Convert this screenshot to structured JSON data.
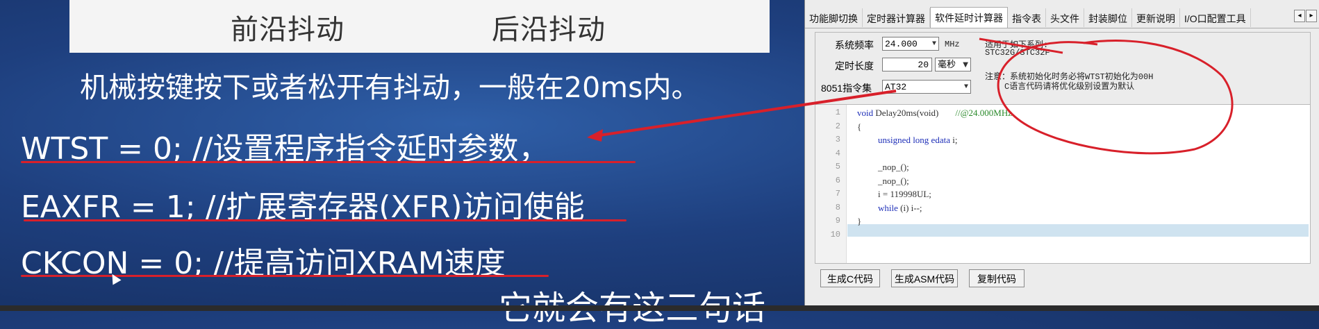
{
  "slide": {
    "figure_labels": [
      "前沿抖动",
      "后沿抖动"
    ],
    "description": "机械按键按下或者松开有抖动，一般在20ms内。",
    "code_lines": [
      "WTST = 0;  //设置程序指令延时参数，",
      "EAXFR = 1; //扩展寄存器(XFR)访问使能",
      "CKCON = 0; //提高访问XRAM速度"
    ],
    "caption_fragment": "它就会有这三句话"
  },
  "tool": {
    "tabs": [
      "功能脚切换",
      "定时器计算器",
      "软件延时计算器",
      "指令表",
      "头文件",
      "封装脚位",
      "更新说明",
      "I/O口配置工具"
    ],
    "active_tab": "软件延时计算器",
    "scroll_left": "◂",
    "scroll_right": "▸",
    "freq_label": "系统频率",
    "freq_value": "24.000",
    "freq_unit": "MHz",
    "delay_label": "定时长度",
    "delay_value": "20",
    "delay_unit": "毫秒",
    "isa_label": "8051指令集",
    "isa_value": "AT32",
    "note_lines": [
      "适用于如下系列:",
      "STC32G/STC32F",
      "注意：系统初始化时务必将WTST初始化为00H",
      "C语言代码请将优化级别设置为默认"
    ],
    "line_numbers": [
      "1",
      "2",
      "3",
      "4",
      "5",
      "6",
      "7",
      "8",
      "9",
      "10"
    ],
    "code": [
      {
        "kw": "void",
        "text": " Delay20ms(void)",
        "comment": "//@24.000MHz"
      },
      {
        "kw": "",
        "text": "{",
        "comment": ""
      },
      {
        "kw": "unsigned long edata",
        "text": " i;",
        "comment": ""
      },
      {
        "kw": "",
        "text": "",
        "comment": ""
      },
      {
        "kw": "",
        "text": "_nop_();",
        "comment": ""
      },
      {
        "kw": "",
        "text": "_nop_();",
        "comment": ""
      },
      {
        "kw": "",
        "text": "i = 119998UL;",
        "comment": ""
      },
      {
        "kw": "while",
        "text": " (i) i--;",
        "comment": ""
      },
      {
        "kw": "",
        "text": "}",
        "comment": ""
      },
      {
        "kw": "",
        "text": "",
        "comment": ""
      }
    ],
    "buttons": [
      "生成C代码",
      "生成ASM代码",
      "复制代码"
    ]
  },
  "colors": {
    "background": "#1e3f7e",
    "annotation_red": "#d8202a",
    "keyword_blue": "#1e2fb8",
    "comment_green": "#2b8a2b",
    "highlight_line": "#cfe3f0"
  }
}
